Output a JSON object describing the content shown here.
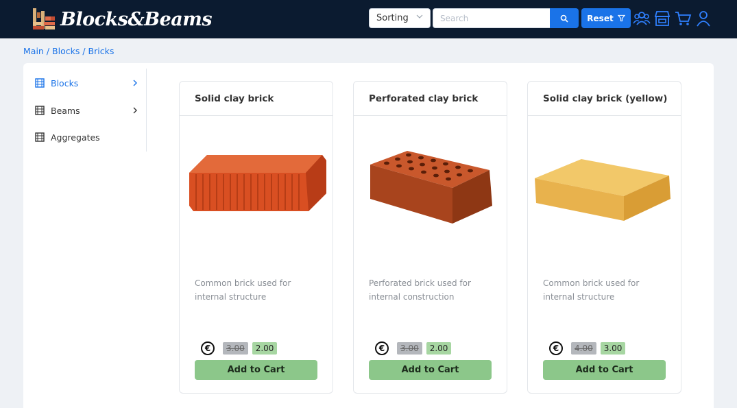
{
  "header": {
    "brand": "Blocks&Beams",
    "sorting_label": "Sorting",
    "search_placeholder": "Search",
    "reset_label": "Reset"
  },
  "breadcrumb": {
    "main": "Main",
    "sep1": " / ",
    "blocks": "Blocks",
    "sep2": " / ",
    "bricks": "Bricks"
  },
  "sidebar": {
    "items": [
      {
        "label": "Blocks",
        "active": true
      },
      {
        "label": "Beams",
        "active": false
      },
      {
        "label": "Aggregates",
        "active": false
      }
    ]
  },
  "products": [
    {
      "title": "Solid clay brick",
      "description": "Common brick used for internal structure",
      "currency": "€",
      "old_price": "3.00",
      "new_price": "2.00",
      "button": "Add to Cart"
    },
    {
      "title": "Perforated clay brick",
      "description": "Perforated brick used for internal construction",
      "currency": "€",
      "old_price": "3.00",
      "new_price": "2.00",
      "button": "Add to Cart"
    },
    {
      "title": "Solid clay brick (yellow)",
      "description": "Common brick used for internal structure",
      "currency": "€",
      "old_price": "4.00",
      "new_price": "3.00",
      "button": "Add to Cart"
    }
  ],
  "colors": {
    "header_bg": "#0b1b30",
    "accent": "#1a73e8",
    "cart_button": "#8cc78a",
    "new_price_bg": "#a7d6a2",
    "old_price_bg": "#b4b7bc"
  },
  "icons": [
    "logo-bricks-icon",
    "chevron-down-icon",
    "search-icon",
    "filter-icon",
    "users-icon",
    "store-icon",
    "cart-icon",
    "user-icon",
    "grid-icon",
    "chevron-right-icon",
    "euro-icon"
  ]
}
